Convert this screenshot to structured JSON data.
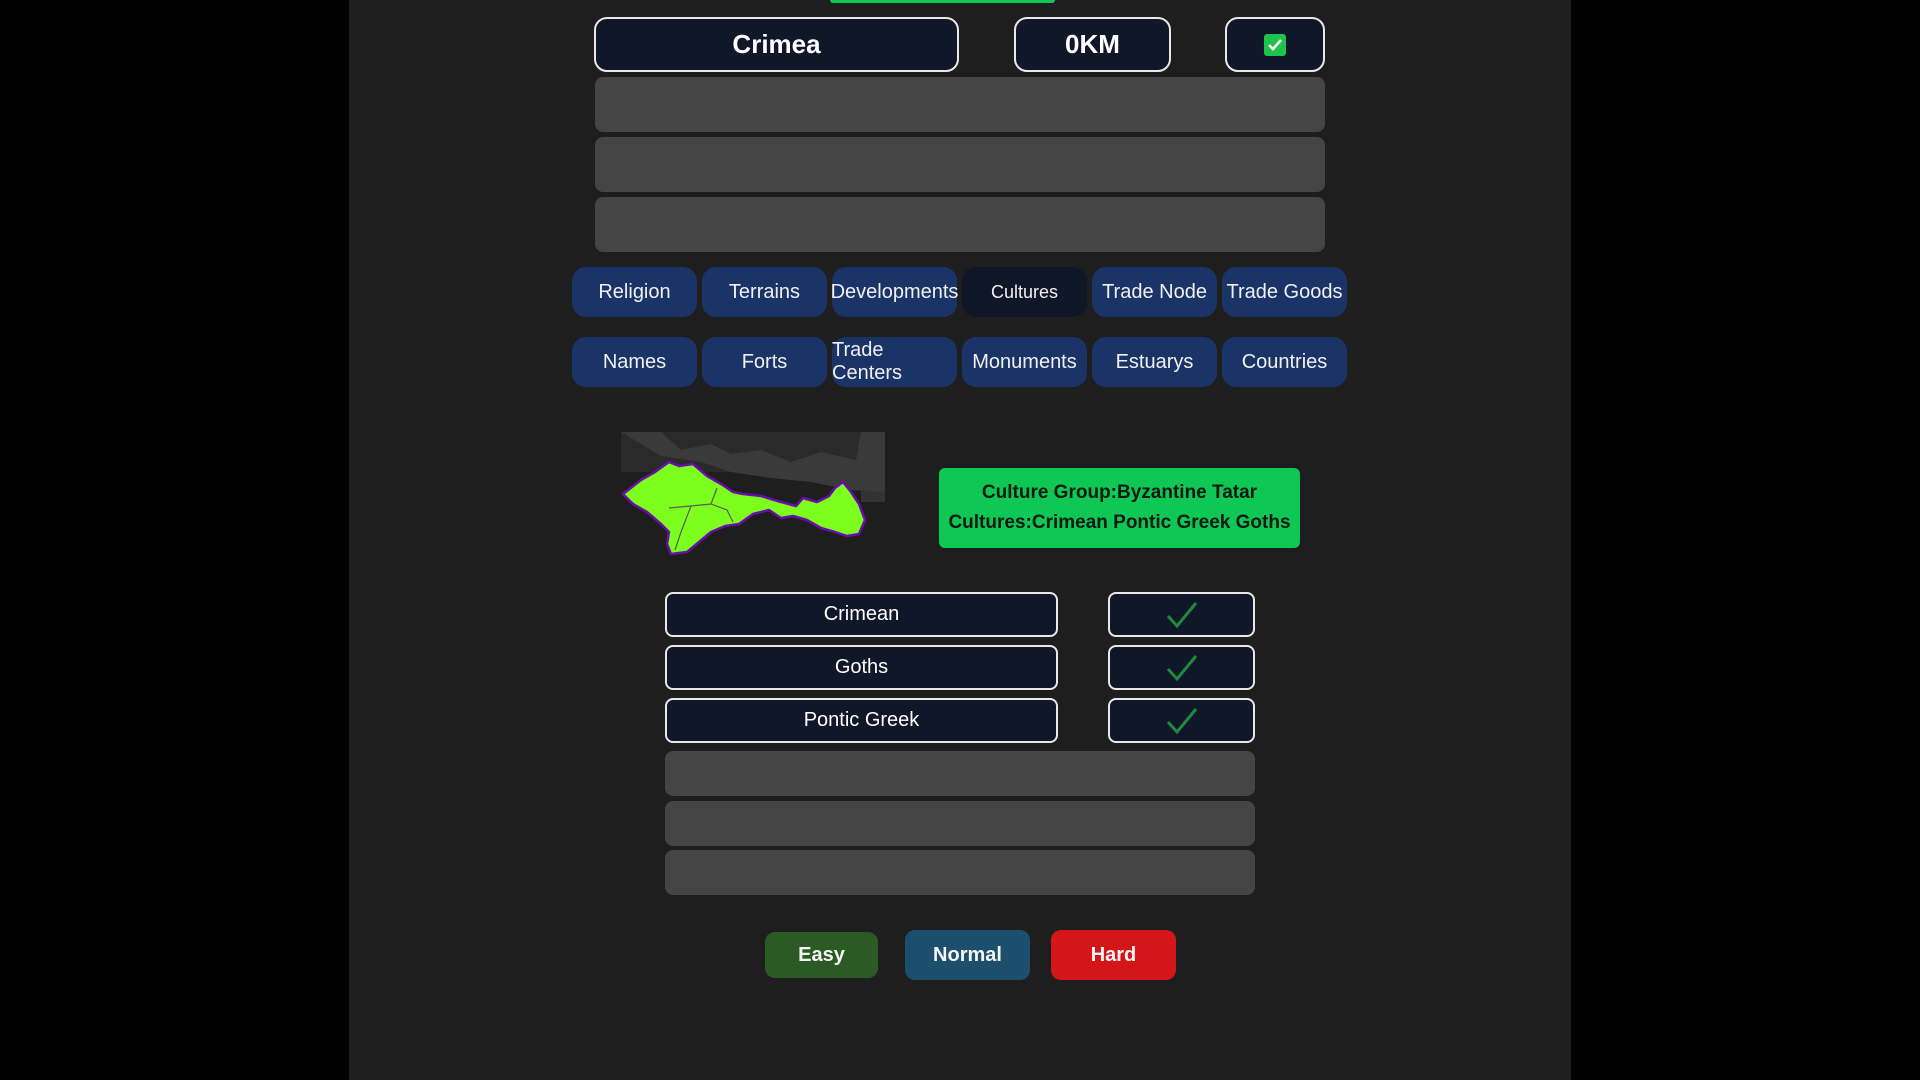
{
  "guess": {
    "value": "Crimea"
  },
  "distance": {
    "value": "0KM"
  },
  "result_check": {
    "icon": "checkmark-icon",
    "color": "#1ec24c"
  },
  "categories": {
    "row1": [
      "Religion",
      "Terrains",
      "Developments",
      "Cultures",
      "Trade Node",
      "Trade Goods"
    ],
    "row2": [
      "Names",
      "Forts",
      "Trade Centers",
      "Monuments",
      "Estuarys",
      "Countries"
    ],
    "active": "Cultures"
  },
  "map": {
    "region_color": "#7dff1e",
    "border_color": "#6a0dad",
    "icon": "region-map"
  },
  "culture_info": {
    "group_line": "Culture Group:Byzantine Tatar",
    "cultures_line": "Cultures:Crimean Pontic Greek Goths",
    "background": "#0fc755"
  },
  "answers": [
    {
      "name": "Crimean",
      "correct": true
    },
    {
      "name": "Goths",
      "correct": true
    },
    {
      "name": "Pontic Greek",
      "correct": true
    }
  ],
  "difficulty": {
    "easy": "Easy",
    "normal": "Normal",
    "hard": "Hard"
  },
  "colors": {
    "accent": "#0fc755",
    "tab": "#1b3468",
    "easy": "#2b5a25",
    "normal": "#1c4f6e",
    "hard": "#d4161b"
  }
}
